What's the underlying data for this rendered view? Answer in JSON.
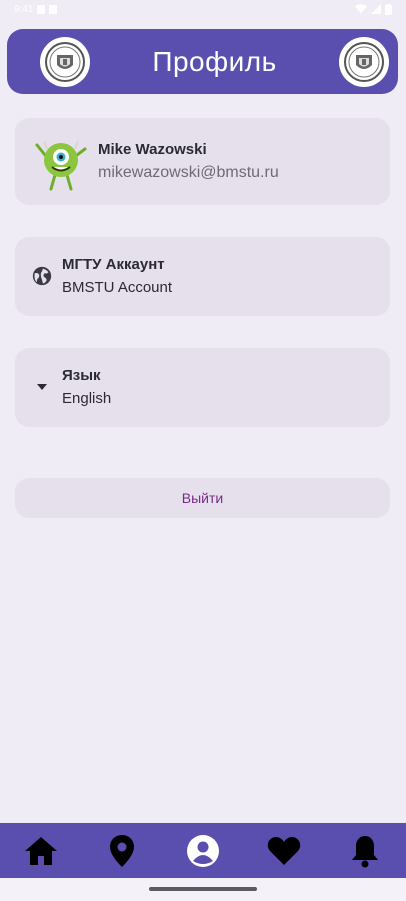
{
  "status_bar": {
    "time": "9:41"
  },
  "header": {
    "title": "Профиль"
  },
  "profile": {
    "name": "Mike Wazowski",
    "email": "mikewazowski@bmstu.ru"
  },
  "account": {
    "title": "МГТУ Аккаунт",
    "subtitle": "BMSTU Account"
  },
  "language": {
    "title": "Язык",
    "value": "English"
  },
  "logout": {
    "label": "Выйти"
  },
  "bottom_nav": {
    "items": [
      "home-icon",
      "location-pin-icon",
      "profile-icon",
      "heart-icon",
      "bell-icon"
    ],
    "active": "profile-icon"
  },
  "colors": {
    "primary": "#5a4fae",
    "background": "#efecf5",
    "card": "#e5e0ec",
    "logout_text": "#7a2b86"
  }
}
